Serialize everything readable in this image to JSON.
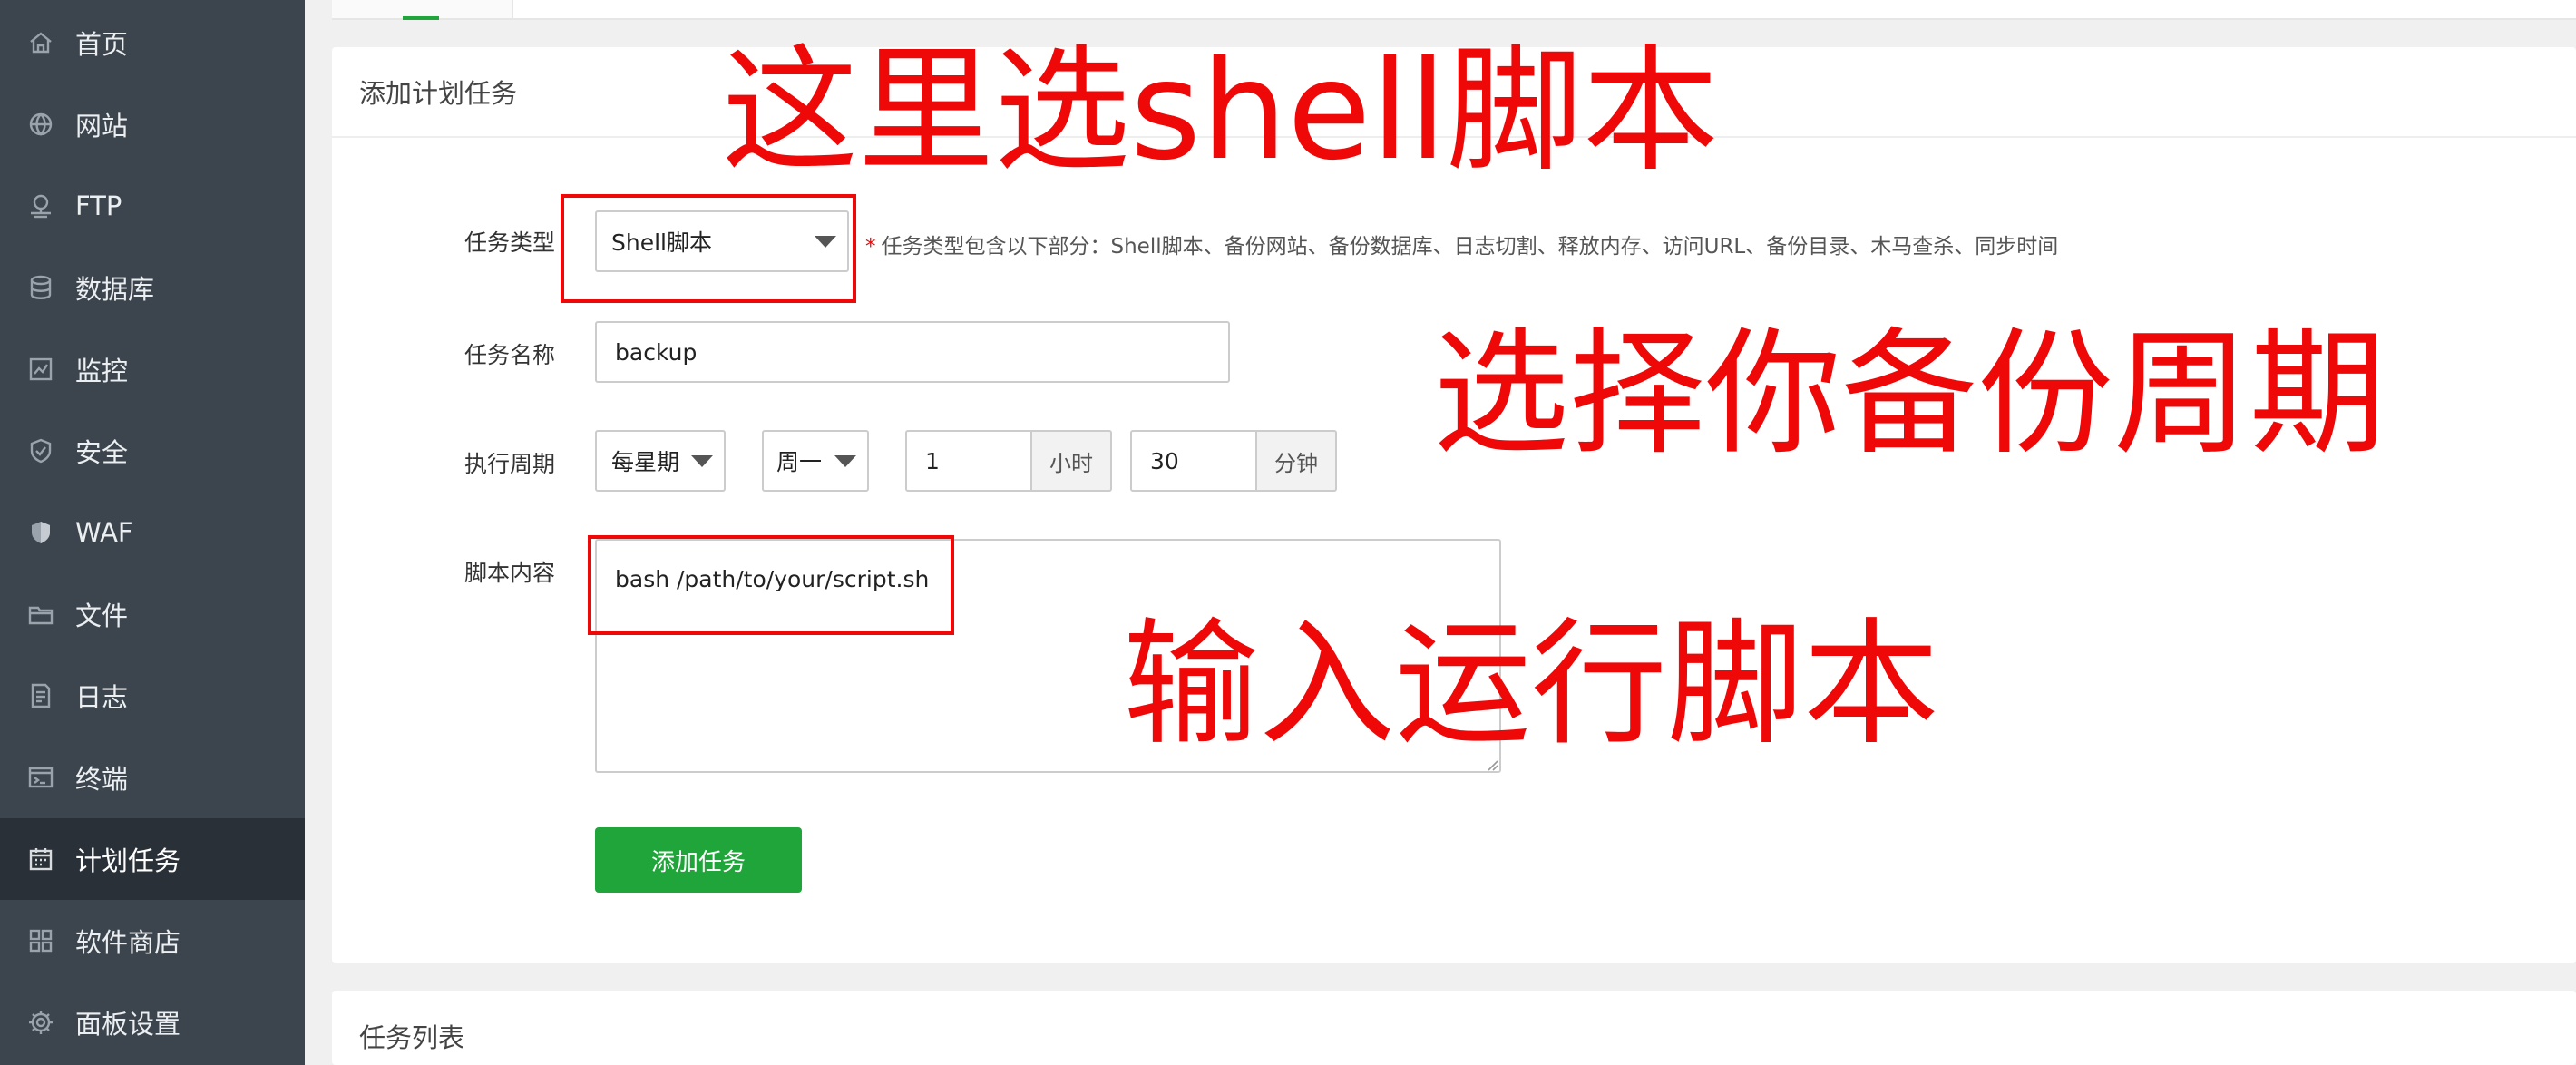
{
  "sidebar": {
    "items": [
      {
        "label": "首页",
        "icon": "home-icon"
      },
      {
        "label": "网站",
        "icon": "globe-icon"
      },
      {
        "label": "FTP",
        "icon": "ftp-icon"
      },
      {
        "label": "数据库",
        "icon": "database-icon"
      },
      {
        "label": "监控",
        "icon": "monitor-icon"
      },
      {
        "label": "安全",
        "icon": "shield-icon"
      },
      {
        "label": "WAF",
        "icon": "waf-shield-icon"
      },
      {
        "label": "文件",
        "icon": "folder-icon"
      },
      {
        "label": "日志",
        "icon": "log-icon"
      },
      {
        "label": "终端",
        "icon": "terminal-icon"
      },
      {
        "label": "计划任务",
        "icon": "calendar-icon",
        "active": true
      },
      {
        "label": "软件商店",
        "icon": "apps-grid-icon"
      },
      {
        "label": "面板设置",
        "icon": "gear-icon"
      }
    ]
  },
  "form_panel": {
    "title": "添加计划任务",
    "task_type": {
      "label": "任务类型",
      "value": "Shell脚本"
    },
    "hint": "任务类型包含以下部分：Shell脚本、备份网站、备份数据库、日志切割、释放内存、访问URL、备份目录、木马查杀、同步时间",
    "task_name": {
      "label": "任务名称",
      "value": "backup"
    },
    "period": {
      "label": "执行周期",
      "frequency": "每星期",
      "weekday": "周一",
      "hour_value": "1",
      "hour_unit": "小时",
      "minute_value": "30",
      "minute_unit": "分钟"
    },
    "script": {
      "label": "脚本内容",
      "value": "bash /path/to/your/script.sh"
    },
    "add_button": "添加任务"
  },
  "list_panel": {
    "title": "任务列表"
  },
  "annotations": {
    "select_shell": "这里选shell脚本",
    "select_period": "选择你备份周期",
    "enter_script": "输入运行脚本"
  },
  "colors": {
    "sidebar_bg": "#3c444d",
    "sidebar_active_bg": "#2a3038",
    "accent_green": "#20a53a",
    "annotation_red": "#ef0808"
  }
}
